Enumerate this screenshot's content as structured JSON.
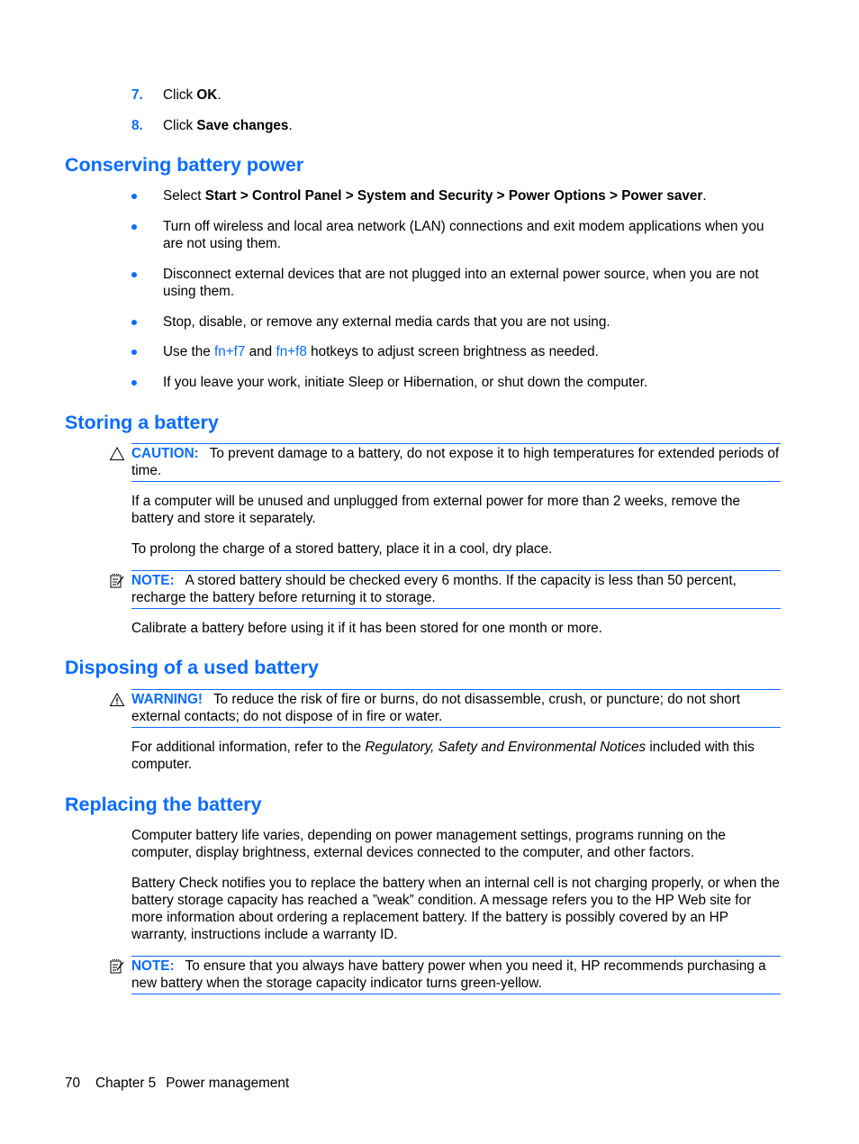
{
  "steps": [
    {
      "number": "7.",
      "prefix": "Click ",
      "bold": "OK",
      "suffix": "."
    },
    {
      "number": "8.",
      "prefix": "Click ",
      "bold": "Save changes",
      "suffix": "."
    }
  ],
  "sections": {
    "conserving": {
      "title": "Conserving battery power",
      "bullets": [
        {
          "prefix": "Select ",
          "bold": "Start > Control Panel > System and Security > Power Options > Power saver",
          "suffix": "."
        },
        {
          "text": "Turn off wireless and local area network (LAN) connections and exit modem applications when you are not using them."
        },
        {
          "text": "Disconnect external devices that are not plugged into an external power source, when you are not using them."
        },
        {
          "text": "Stop, disable, or remove any external media cards that you are not using."
        },
        {
          "prefix": "Use the ",
          "link1": "fn+f7",
          "middle": " and ",
          "link2": "fn+f8",
          "suffix": " hotkeys to adjust screen brightness as needed."
        },
        {
          "text": "If you leave your work, initiate Sleep or Hibernation, or shut down the computer."
        }
      ]
    },
    "storing": {
      "title": "Storing a battery",
      "caution": {
        "icon": "caution-triangle-icon",
        "label": "CAUTION:",
        "text": "To prevent damage to a battery, do not expose it to high temperatures for extended periods of time."
      },
      "para1": "If a computer will be unused and unplugged from external power for more than 2 weeks, remove the battery and store it separately.",
      "para2": "To prolong the charge of a stored battery, place it in a cool, dry place.",
      "note": {
        "icon": "note-pad-icon",
        "label": "NOTE:",
        "text": "A stored battery should be checked every 6 months. If the capacity is less than 50 percent, recharge the battery before returning it to storage."
      },
      "para3": "Calibrate a battery before using it if it has been stored for one month or more."
    },
    "disposing": {
      "title": "Disposing of a used battery",
      "warning": {
        "icon": "warning-triangle-icon",
        "label": "WARNING!",
        "text": "To reduce the risk of fire or burns, do not disassemble, crush, or puncture; do not short external contacts; do not dispose of in fire or water."
      },
      "para_prefix": "For additional information, refer to the ",
      "para_italic": "Regulatory, Safety and Environmental Notices",
      "para_suffix": " included with this computer."
    },
    "replacing": {
      "title": "Replacing the battery",
      "para1": "Computer battery life varies, depending on power management settings, programs running on the computer, display brightness, external devices connected to the computer, and other factors.",
      "para2": "Battery Check notifies you to replace the battery when an internal cell is not charging properly, or when the battery storage capacity has reached a ”weak” condition. A message refers you to the HP Web site for more information about ordering a replacement battery. If the battery is possibly covered by an HP warranty, instructions include a warranty ID.",
      "note": {
        "icon": "note-pad-icon",
        "label": "NOTE:",
        "text": "To ensure that you always have battery power when you need it, HP recommends purchasing a new battery when the storage capacity indicator turns green-yellow."
      }
    }
  },
  "footer": {
    "page_number": "70",
    "chapter": "Chapter 5",
    "chapter_title": "Power management"
  },
  "colors": {
    "accent": "#0a6cff",
    "text": "#000000"
  }
}
